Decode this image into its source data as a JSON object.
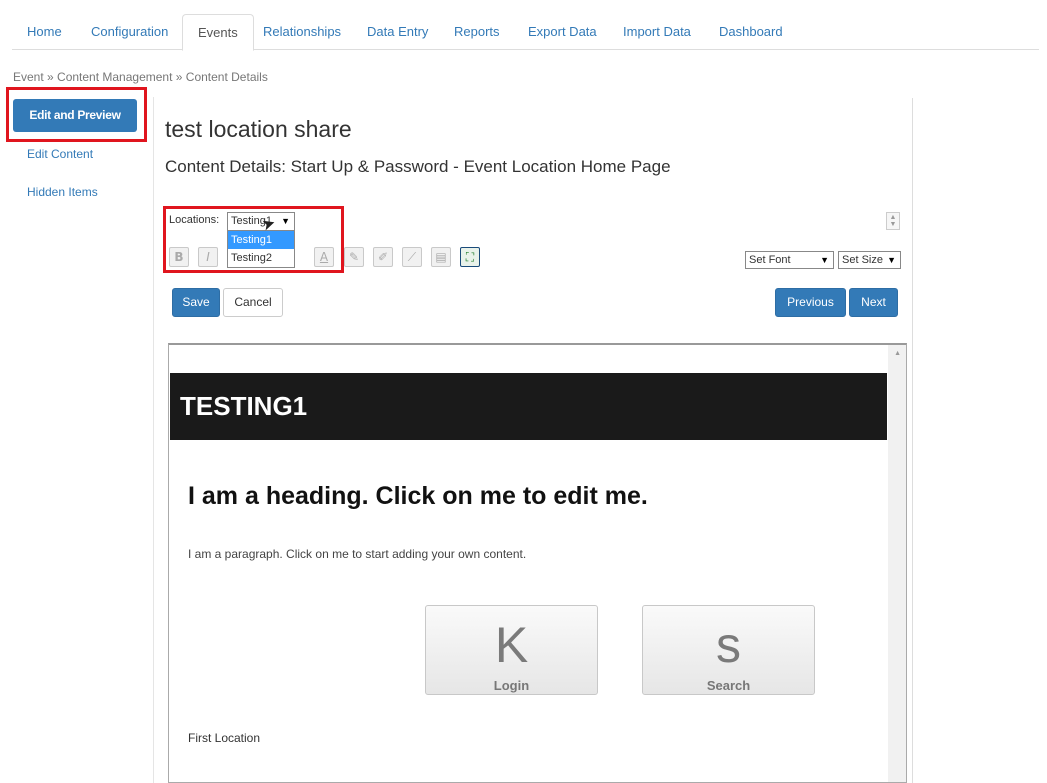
{
  "nav": {
    "tabs": [
      {
        "label": "Home"
      },
      {
        "label": "Configuration"
      },
      {
        "label": "Events",
        "active": true
      },
      {
        "label": "Relationships"
      },
      {
        "label": "Data Entry"
      },
      {
        "label": "Reports"
      },
      {
        "label": "Export Data"
      },
      {
        "label": "Import Data"
      },
      {
        "label": "Dashboard"
      }
    ]
  },
  "breadcrumb": "Event » Content Management » Content Details",
  "sidebar": {
    "active_button": "Edit and Preview",
    "links": [
      "Edit Content",
      "Hidden Items"
    ]
  },
  "page": {
    "title": "test location share",
    "subtitle": "Content Details: Start Up & Password - Event Location Home Page"
  },
  "locations": {
    "label": "Locations:",
    "selected": "Testing1",
    "options": [
      "Testing1",
      "Testing2"
    ]
  },
  "toolbar": {
    "icons": [
      "bold-icon",
      "italic-icon",
      "font-color-icon",
      "background-color-icon",
      "highlight-icon",
      "eraser-icon",
      "clear-format-icon",
      "paste-icon",
      "fullscreen-icon"
    ],
    "set_font": "Set Font",
    "set_size": "Set Size"
  },
  "buttons": {
    "save": "Save",
    "cancel": "Cancel",
    "previous": "Previous",
    "next": "Next"
  },
  "preview": {
    "banner": "TESTING1",
    "heading": "I am a heading. Click on me to edit me.",
    "paragraph": "I am a paragraph. Click on me to start adding your own content.",
    "tiles": [
      {
        "icon": "K",
        "label": "Login"
      },
      {
        "icon": "s",
        "label": "Search"
      }
    ],
    "footer_text": "First Location"
  },
  "colors": {
    "primary": "#337ab7",
    "highlight": "#e0151e",
    "banner": "#1a1a1a"
  }
}
